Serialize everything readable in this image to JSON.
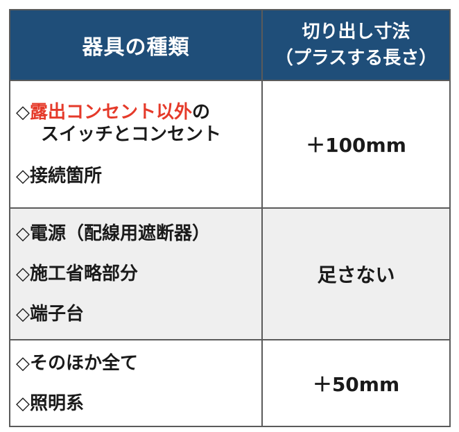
{
  "header": {
    "col1": "器具の種類",
    "col2_line1": "切り出し寸法",
    "col2_line2": "（プラスする長さ）"
  },
  "rows": [
    {
      "item1_prefix": "◇",
      "item1_highlight": "露出コンセント以外",
      "item1_suffix": "の",
      "item1_line2": "スイッチとコンセント",
      "item2": "◇接続箇所",
      "value": "＋100mm"
    },
    {
      "item1": "◇電源（配線用遮断器）",
      "item2": "◇施工省略部分",
      "item3": "◇端子台",
      "value": "足さない"
    },
    {
      "item1": "◇そのほか全て",
      "item2": "◇照明系",
      "value": "＋50mm"
    }
  ],
  "colors": {
    "header_bg": "#1f4e79",
    "highlight": "#e53a2a",
    "shaded_row": "#efefef"
  }
}
